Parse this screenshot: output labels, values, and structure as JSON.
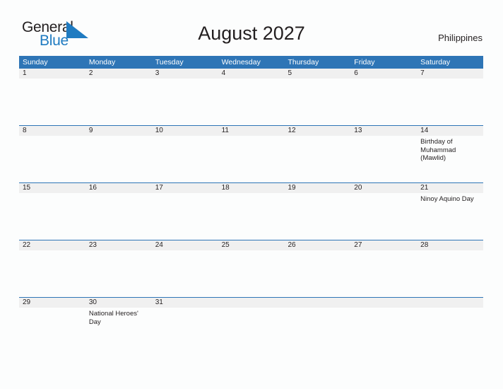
{
  "brand": {
    "name_part1": "General",
    "name_part2": "Blue",
    "flag_icon": "triangle-flag-icon",
    "color_dark": "#231f20",
    "color_blue": "#1f7bc1"
  },
  "header": {
    "title": "August 2027",
    "region": "Philippines"
  },
  "theme": {
    "header_blue": "#2e75b6",
    "date_band_gray": "#f0f0f0",
    "page_background": "#fcfdfd",
    "text_color": "#231f20"
  },
  "calendar": {
    "weekdays": [
      "Sunday",
      "Monday",
      "Tuesday",
      "Wednesday",
      "Thursday",
      "Friday",
      "Saturday"
    ],
    "weeks": [
      [
        {
          "date": "1",
          "events": []
        },
        {
          "date": "2",
          "events": []
        },
        {
          "date": "3",
          "events": []
        },
        {
          "date": "4",
          "events": []
        },
        {
          "date": "5",
          "events": []
        },
        {
          "date": "6",
          "events": []
        },
        {
          "date": "7",
          "events": []
        }
      ],
      [
        {
          "date": "8",
          "events": []
        },
        {
          "date": "9",
          "events": []
        },
        {
          "date": "10",
          "events": []
        },
        {
          "date": "11",
          "events": []
        },
        {
          "date": "12",
          "events": []
        },
        {
          "date": "13",
          "events": []
        },
        {
          "date": "14",
          "events": [
            "Birthday of Muhammad (Mawlid)"
          ]
        }
      ],
      [
        {
          "date": "15",
          "events": []
        },
        {
          "date": "16",
          "events": []
        },
        {
          "date": "17",
          "events": []
        },
        {
          "date": "18",
          "events": []
        },
        {
          "date": "19",
          "events": []
        },
        {
          "date": "20",
          "events": []
        },
        {
          "date": "21",
          "events": [
            "Ninoy Aquino Day"
          ]
        }
      ],
      [
        {
          "date": "22",
          "events": []
        },
        {
          "date": "23",
          "events": []
        },
        {
          "date": "24",
          "events": []
        },
        {
          "date": "25",
          "events": []
        },
        {
          "date": "26",
          "events": []
        },
        {
          "date": "27",
          "events": []
        },
        {
          "date": "28",
          "events": []
        }
      ],
      [
        {
          "date": "29",
          "events": []
        },
        {
          "date": "30",
          "events": [
            "National Heroes' Day"
          ]
        },
        {
          "date": "31",
          "events": []
        },
        {
          "date": "",
          "events": []
        },
        {
          "date": "",
          "events": []
        },
        {
          "date": "",
          "events": []
        },
        {
          "date": "",
          "events": []
        }
      ]
    ]
  }
}
